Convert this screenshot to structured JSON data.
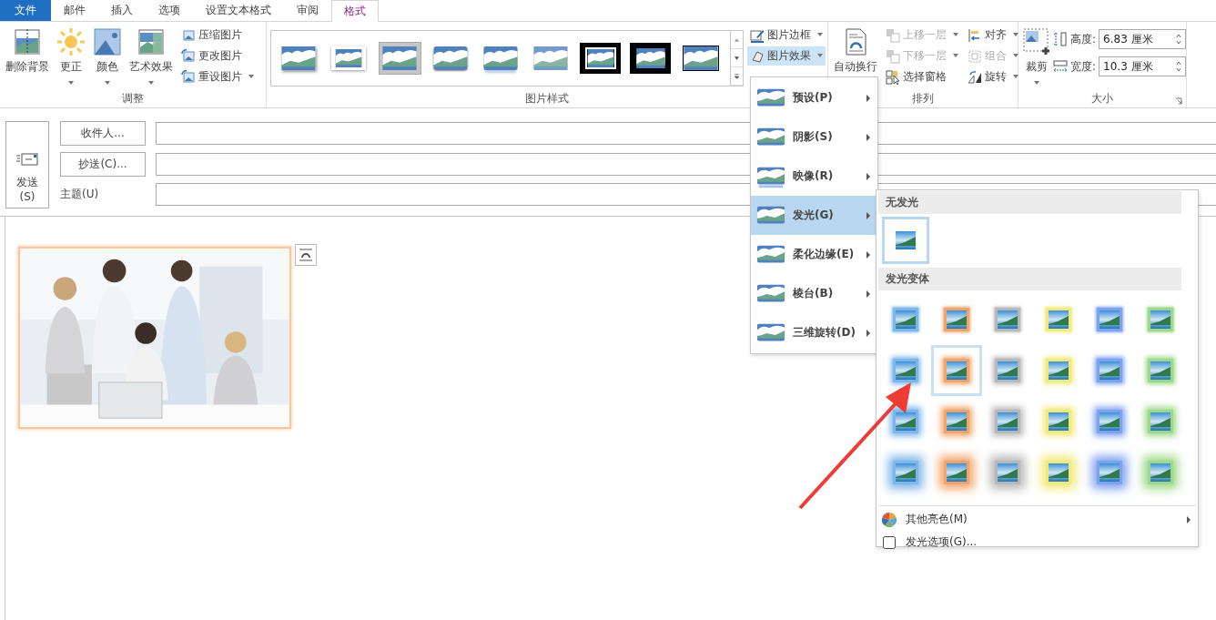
{
  "tabs": [
    {
      "label": "文件",
      "kind": "file",
      "selected": false
    },
    {
      "label": "邮件",
      "kind": "tab",
      "selected": false
    },
    {
      "label": "插入",
      "kind": "tab",
      "selected": false
    },
    {
      "label": "选项",
      "kind": "tab",
      "selected": false
    },
    {
      "label": "设置文本格式",
      "kind": "tab",
      "selected": false
    },
    {
      "label": "审阅",
      "kind": "tab",
      "selected": false
    },
    {
      "label": "格式",
      "kind": "tab",
      "selected": true
    }
  ],
  "ribbon": {
    "adjust": {
      "title": "调整",
      "large": [
        {
          "label": "删除背景",
          "dropdown": false
        },
        {
          "label": "更正",
          "dropdown": true
        },
        {
          "label": "颜色",
          "dropdown": true
        },
        {
          "label": "艺术效果",
          "dropdown": true
        }
      ],
      "small": [
        {
          "label": "压缩图片",
          "dropdown": false
        },
        {
          "label": "更改图片",
          "dropdown": false
        },
        {
          "label": "重设图片",
          "dropdown": true
        }
      ]
    },
    "styles": {
      "title": "图片样式",
      "thumbs": [
        {
          "kind": "shadow",
          "selected": false
        },
        {
          "kind": "frame",
          "selected": false
        },
        {
          "kind": "plain",
          "selected": true
        },
        {
          "kind": "rounded",
          "selected": false
        },
        {
          "kind": "reflect",
          "selected": false
        },
        {
          "kind": "soft",
          "selected": false
        },
        {
          "kind": "double-black",
          "selected": false
        },
        {
          "kind": "thick-black",
          "selected": false
        },
        {
          "kind": "thin-black",
          "selected": false
        }
      ],
      "border": "图片边框",
      "effects": {
        "label": "图片效果",
        "open": true
      }
    },
    "arrange": {
      "title": "排列",
      "wrap": "自动换行",
      "items": [
        {
          "label": "上移一层",
          "disabled": true,
          "dropdown": true
        },
        {
          "label": "下移一层",
          "disabled": true,
          "dropdown": true
        },
        {
          "label": "选择窗格",
          "disabled": false,
          "dropdown": false
        },
        {
          "label": "对齐",
          "disabled": false,
          "dropdown": true
        },
        {
          "label": "组合",
          "disabled": true,
          "dropdown": true
        },
        {
          "label": "旋转",
          "disabled": false,
          "dropdown": true
        }
      ]
    },
    "size": {
      "title": "大小",
      "crop": "裁剪",
      "height_label": "高度:",
      "height": "6.83 厘米",
      "width_label": "宽度:",
      "width": "10.3 厘米"
    }
  },
  "compose": {
    "send": "发送",
    "send_key": "(S)",
    "to": "收件人...",
    "cc": "抄送(C)...",
    "subject": "主题(U)"
  },
  "effects_menu": [
    {
      "label": "预设(P)",
      "selected": false
    },
    {
      "label": "阴影(S)",
      "selected": false
    },
    {
      "label": "映像(R)",
      "selected": false
    },
    {
      "label": "发光(G)",
      "selected": true
    },
    {
      "label": "柔化边缘(E)",
      "selected": false
    },
    {
      "label": "棱台(B)",
      "selected": false
    },
    {
      "label": "三维旋转(D)",
      "selected": false
    }
  ],
  "glow_menu": {
    "none_header": "无发光",
    "none_selected": true,
    "variants_header": "发光变体",
    "variants": [
      {
        "items": [
          {
            "color": "#7fb6ea",
            "selected": false
          },
          {
            "color": "#f4a46a",
            "selected": false
          },
          {
            "color": "#b8b8b8",
            "selected": false
          },
          {
            "color": "#f3ea7c",
            "selected": false
          },
          {
            "color": "#7ea2ee",
            "selected": false
          },
          {
            "color": "#9ed98a",
            "selected": false
          }
        ]
      },
      {
        "items": [
          {
            "color": "#7fb6ea",
            "selected": false
          },
          {
            "color": "#f4a46a",
            "selected": true
          },
          {
            "color": "#b8b8b8",
            "selected": false
          },
          {
            "color": "#f3ea7c",
            "selected": false
          },
          {
            "color": "#7ea2ee",
            "selected": false
          },
          {
            "color": "#9ed98a",
            "selected": false
          }
        ]
      },
      {
        "items": [
          {
            "color": "#7fb6ea",
            "selected": false
          },
          {
            "color": "#f4a46a",
            "selected": false
          },
          {
            "color": "#b8b8b8",
            "selected": false
          },
          {
            "color": "#f3ea7c",
            "selected": false
          },
          {
            "color": "#7ea2ee",
            "selected": false
          },
          {
            "color": "#9ed98a",
            "selected": false
          }
        ]
      },
      {
        "items": [
          {
            "color": "#7fb6ea",
            "selected": false
          },
          {
            "color": "#f4a46a",
            "selected": false
          },
          {
            "color": "#b8b8b8",
            "selected": false
          },
          {
            "color": "#f3ea7c",
            "selected": false
          },
          {
            "color": "#7ea2ee",
            "selected": false
          },
          {
            "color": "#9ed98a",
            "selected": false
          }
        ]
      }
    ],
    "more_colors": "其他亮色(M)",
    "options": "发光选项(G)..."
  }
}
